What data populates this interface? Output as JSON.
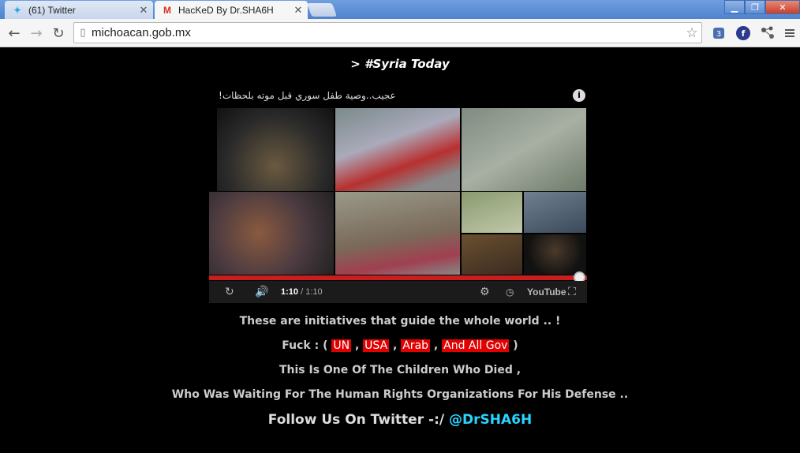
{
  "browser": {
    "tabs": [
      {
        "title": "(61) Twitter",
        "icon": "twitter-bird"
      },
      {
        "title": "HacKeD By Dr.SHA6H",
        "icon": "gmail-m"
      }
    ],
    "url": "michoacan.gob.mx"
  },
  "page": {
    "title": "> #Syria Today",
    "video": {
      "title": "!عجيب..وصية طفل سوري قبل موته بلحظات",
      "time_current": "1:10",
      "time_total": "/ 1:10",
      "progress": 1.0,
      "brand": "YouTube"
    },
    "line1": "These are initiatives that guide the whole world .. !",
    "line2_prefix": "Fuck : (",
    "tags": [
      "UN",
      "USA",
      "Arab",
      "And All Gov"
    ],
    "separator": ",",
    "line2_suffix": ")",
    "line3": "This Is One Of The Children Who Died ,",
    "line4": "Who Was Waiting For The Human Rights Organizations For His Defense ..",
    "follow_prefix": "Follow Us On Twitter -:/",
    "follow_handle": "@DrSHA6H"
  },
  "colors": {
    "background": "#000000",
    "highlight": "#e10000",
    "handle": "#29d4ff",
    "progress": "#c81e1e"
  }
}
